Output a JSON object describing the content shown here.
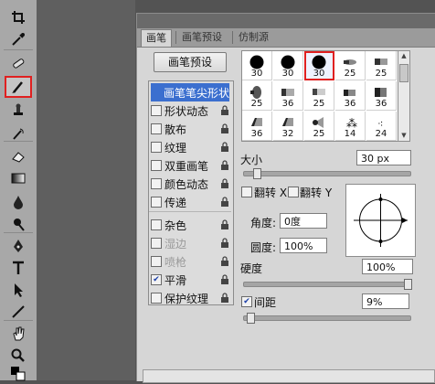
{
  "tools": [
    {
      "name": "crop-tool",
      "icon": "crop-icon",
      "highlighted": false
    },
    {
      "name": "eyedropper-tool",
      "icon": "eyedropper-icon",
      "highlighted": false
    },
    {
      "name": "healing-brush-tool",
      "icon": "bandage-icon",
      "highlighted": false
    },
    {
      "name": "brush-tool",
      "icon": "brush-icon",
      "highlighted": true
    },
    {
      "name": "clone-stamp-tool",
      "icon": "stamp-icon",
      "highlighted": false
    },
    {
      "name": "history-brush-tool",
      "icon": "history-brush-icon",
      "highlighted": false
    },
    {
      "name": "eraser-tool",
      "icon": "eraser-icon",
      "highlighted": false
    },
    {
      "name": "gradient-tool",
      "icon": "gradient-icon",
      "highlighted": false
    },
    {
      "name": "blur-tool",
      "icon": "drop-icon",
      "highlighted": false
    },
    {
      "name": "dodge-tool",
      "icon": "dodge-icon",
      "highlighted": false
    },
    {
      "name": "pen-tool",
      "icon": "pen-icon",
      "highlighted": false
    },
    {
      "name": "type-tool",
      "icon": "type-icon",
      "highlighted": false
    },
    {
      "name": "path-selection-tool",
      "icon": "arrow-icon",
      "highlighted": false
    },
    {
      "name": "line-tool",
      "icon": "line-icon",
      "highlighted": false
    },
    {
      "name": "hand-tool",
      "icon": "hand-icon",
      "highlighted": false
    },
    {
      "name": "zoom-tool",
      "icon": "zoom-icon",
      "highlighted": false
    }
  ],
  "tabs": [
    "画笔",
    "画笔预设",
    "仿制源"
  ],
  "preset_button": "画笔预设",
  "options": [
    {
      "label": "画笔笔尖形状",
      "checkbox": false,
      "checked": false,
      "lock": false,
      "selected": true,
      "disabled": false
    },
    {
      "label": "形状动态",
      "checkbox": true,
      "checked": false,
      "lock": true,
      "selected": false,
      "disabled": false
    },
    {
      "label": "散布",
      "checkbox": true,
      "checked": false,
      "lock": true,
      "selected": false,
      "disabled": false
    },
    {
      "label": "纹理",
      "checkbox": true,
      "checked": false,
      "lock": true,
      "selected": false,
      "disabled": false
    },
    {
      "label": "双重画笔",
      "checkbox": true,
      "checked": false,
      "lock": true,
      "selected": false,
      "disabled": false
    },
    {
      "label": "颜色动态",
      "checkbox": true,
      "checked": false,
      "lock": true,
      "selected": false,
      "disabled": false
    },
    {
      "label": "传递",
      "checkbox": true,
      "checked": false,
      "lock": true,
      "selected": false,
      "disabled": false
    },
    {
      "label": "杂色",
      "checkbox": true,
      "checked": false,
      "lock": true,
      "selected": false,
      "disabled": false
    },
    {
      "label": "湿边",
      "checkbox": true,
      "checked": false,
      "lock": true,
      "selected": false,
      "disabled": true
    },
    {
      "label": "喷枪",
      "checkbox": true,
      "checked": false,
      "lock": true,
      "selected": false,
      "disabled": true
    },
    {
      "label": "平滑",
      "checkbox": true,
      "checked": true,
      "lock": true,
      "selected": false,
      "disabled": false
    },
    {
      "label": "保护纹理",
      "checkbox": true,
      "checked": false,
      "lock": true,
      "selected": false,
      "disabled": false
    }
  ],
  "brush_tips": [
    {
      "size": "30",
      "shape": "round-hard"
    },
    {
      "size": "30",
      "shape": "round-hard"
    },
    {
      "size": "30",
      "shape": "round-hard",
      "selected": true
    },
    {
      "size": "25",
      "shape": "flat"
    },
    {
      "size": "25",
      "shape": "flat-wide"
    },
    {
      "size": "25",
      "shape": "round-soft"
    },
    {
      "size": "36",
      "shape": "chalk"
    },
    {
      "size": "25",
      "shape": "chalk-light"
    },
    {
      "size": "36",
      "shape": "brush-a"
    },
    {
      "size": "36",
      "shape": "brush-b"
    },
    {
      "size": "36",
      "shape": "flat-angled"
    },
    {
      "size": "32",
      "shape": "flat-angled"
    },
    {
      "size": "25",
      "shape": "fan"
    },
    {
      "size": "14",
      "shape": "spatter"
    },
    {
      "size": "24",
      "shape": "spatter-small"
    }
  ],
  "size": {
    "label": "大小",
    "value": "30 px",
    "fraction": 0.06
  },
  "flip_x": {
    "label": "翻转 X",
    "checked": false
  },
  "flip_y": {
    "label": "翻转 Y",
    "checked": false
  },
  "angle": {
    "label": "角度:",
    "value": "0度"
  },
  "roundness": {
    "label": "圆度:",
    "value": "100%"
  },
  "hardness": {
    "label": "硬度",
    "value": "100%",
    "fraction": 1.0
  },
  "spacing": {
    "label": "间距",
    "value": "9%",
    "checked": true,
    "fraction": 0.02
  }
}
